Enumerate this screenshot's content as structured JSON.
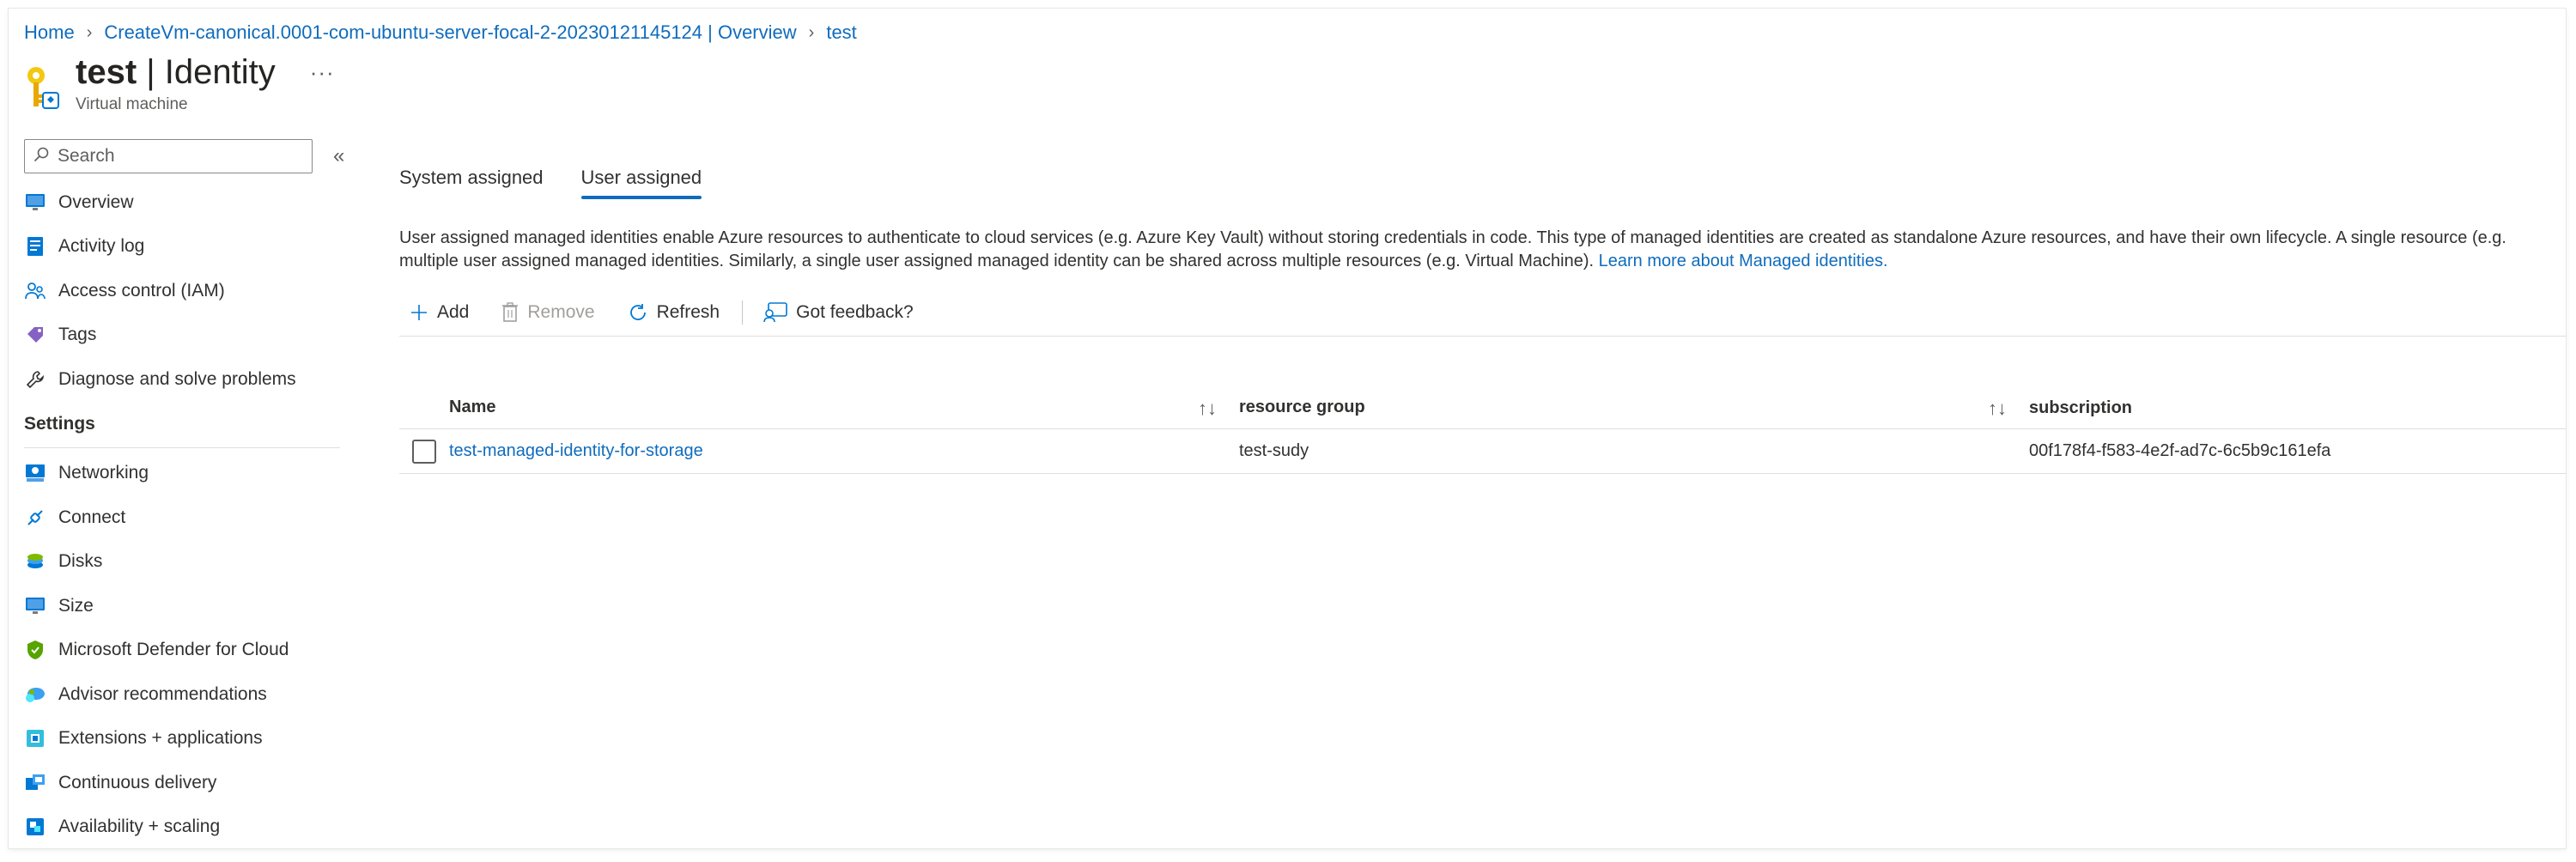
{
  "breadcrumb": {
    "home": "Home",
    "overview": "CreateVm-canonical.0001-com-ubuntu-server-focal-2-20230121145124 | Overview",
    "current": "test"
  },
  "header": {
    "resource_name": "test",
    "page_name": "| Identity",
    "more": "···",
    "subtitle": "Virtual machine"
  },
  "nav": {
    "search_placeholder": "Search",
    "collapse": "«",
    "items_top": [
      {
        "label": "Overview",
        "icon": "monitor-icon"
      },
      {
        "label": "Activity log",
        "icon": "activity-log-icon"
      },
      {
        "label": "Access control (IAM)",
        "icon": "people-icon"
      },
      {
        "label": "Tags",
        "icon": "tag-icon"
      },
      {
        "label": "Diagnose and solve problems",
        "icon": "wrench-icon"
      }
    ],
    "section_settings": "Settings",
    "items_settings": [
      {
        "label": "Networking",
        "icon": "networking-icon"
      },
      {
        "label": "Connect",
        "icon": "connect-icon"
      },
      {
        "label": "Disks",
        "icon": "disks-icon"
      },
      {
        "label": "Size",
        "icon": "size-icon"
      },
      {
        "label": "Microsoft Defender for Cloud",
        "icon": "shield-icon"
      },
      {
        "label": "Advisor recommendations",
        "icon": "advisor-icon"
      },
      {
        "label": "Extensions + applications",
        "icon": "extensions-icon"
      },
      {
        "label": "Continuous delivery",
        "icon": "delivery-icon"
      },
      {
        "label": "Availability + scaling",
        "icon": "availability-icon"
      }
    ]
  },
  "tabs": {
    "system": "System assigned",
    "user": "User assigned"
  },
  "description": {
    "line1": "User assigned managed identities enable Azure resources to authenticate to cloud services (e.g. Azure Key Vault) without storing credentials in code. This type of managed identities are created as standalone Azure resources, and have their own lifecycle. A single resource (e.g.",
    "line2": "multiple user assigned managed identities. Similarly, a single user assigned managed identity can be shared across multiple resources (e.g. Virtual Machine).",
    "link": "Learn more about Managed identities."
  },
  "toolbar": {
    "add": "Add",
    "remove": "Remove",
    "refresh": "Refresh",
    "feedback": "Got feedback?"
  },
  "table": {
    "columns": {
      "name": "Name",
      "resource_group": "resource group",
      "subscription": "subscription"
    },
    "sort_glyph": "↑↓",
    "rows": [
      {
        "name": "test-managed-identity-for-storage",
        "resource_group": "test-sudy",
        "subscription": "00f178f4-f583-4e2f-ad7c-6c5b9c161efa"
      }
    ]
  },
  "colors": {
    "accent": "#0f6cbd",
    "text": "#323130",
    "muted": "#605e5c"
  }
}
